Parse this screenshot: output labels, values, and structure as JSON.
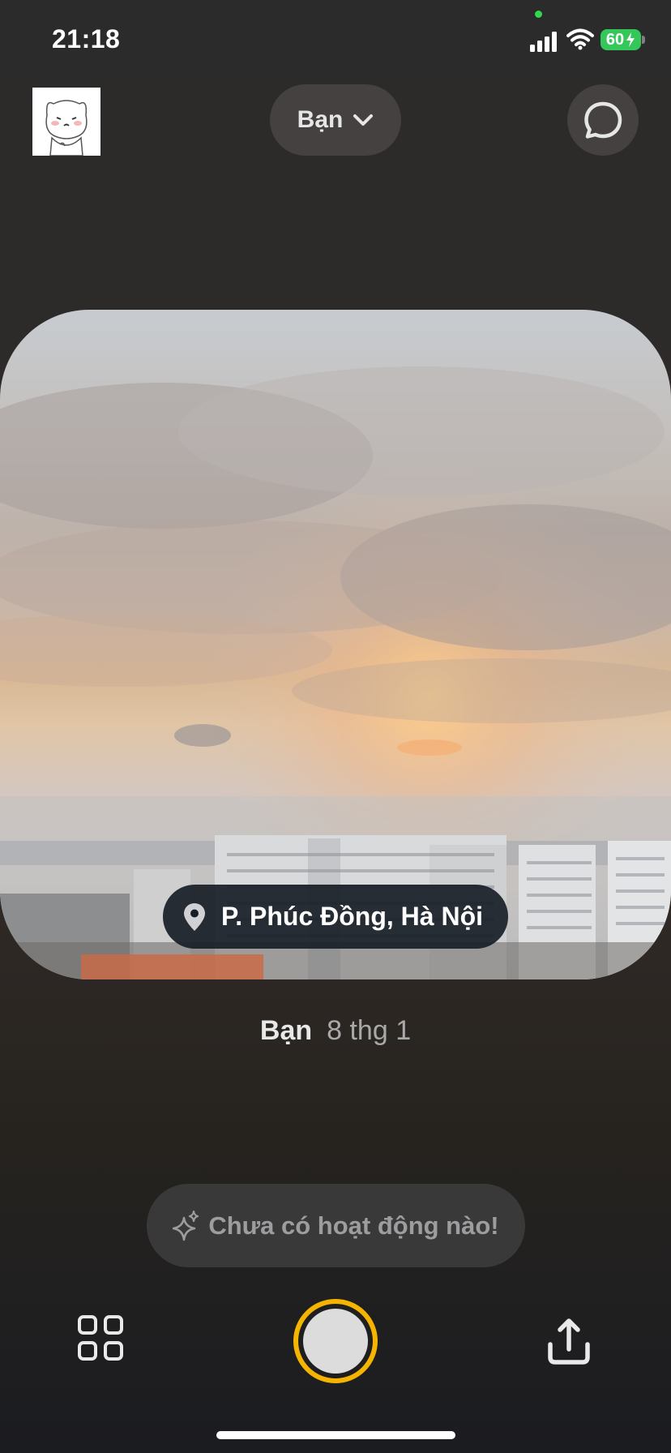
{
  "status_bar": {
    "time": "21:18",
    "battery": "60",
    "icons": [
      "signal-icon",
      "wifi-icon",
      "battery-charging-icon"
    ]
  },
  "header": {
    "audience_selector_label": "Bạn",
    "icons": [
      "avatar",
      "chevron-down-icon",
      "chat-bubble-icon"
    ]
  },
  "post": {
    "location": "P. Phúc Đồng, Hà Nội",
    "author": "Bạn",
    "date": "8 thg 1"
  },
  "activity": {
    "text": "Chưa có hoạt động nào!",
    "icon": "sparkle-icon"
  },
  "bottom_bar": {
    "icons": [
      "grid-icon",
      "shutter-button",
      "share-icon"
    ],
    "shutter_ring_color": "#f4b400"
  },
  "colors": {
    "pill_bg": "#444140",
    "location_pill_bg": "#181e26",
    "activity_bg": "#3a393a"
  }
}
